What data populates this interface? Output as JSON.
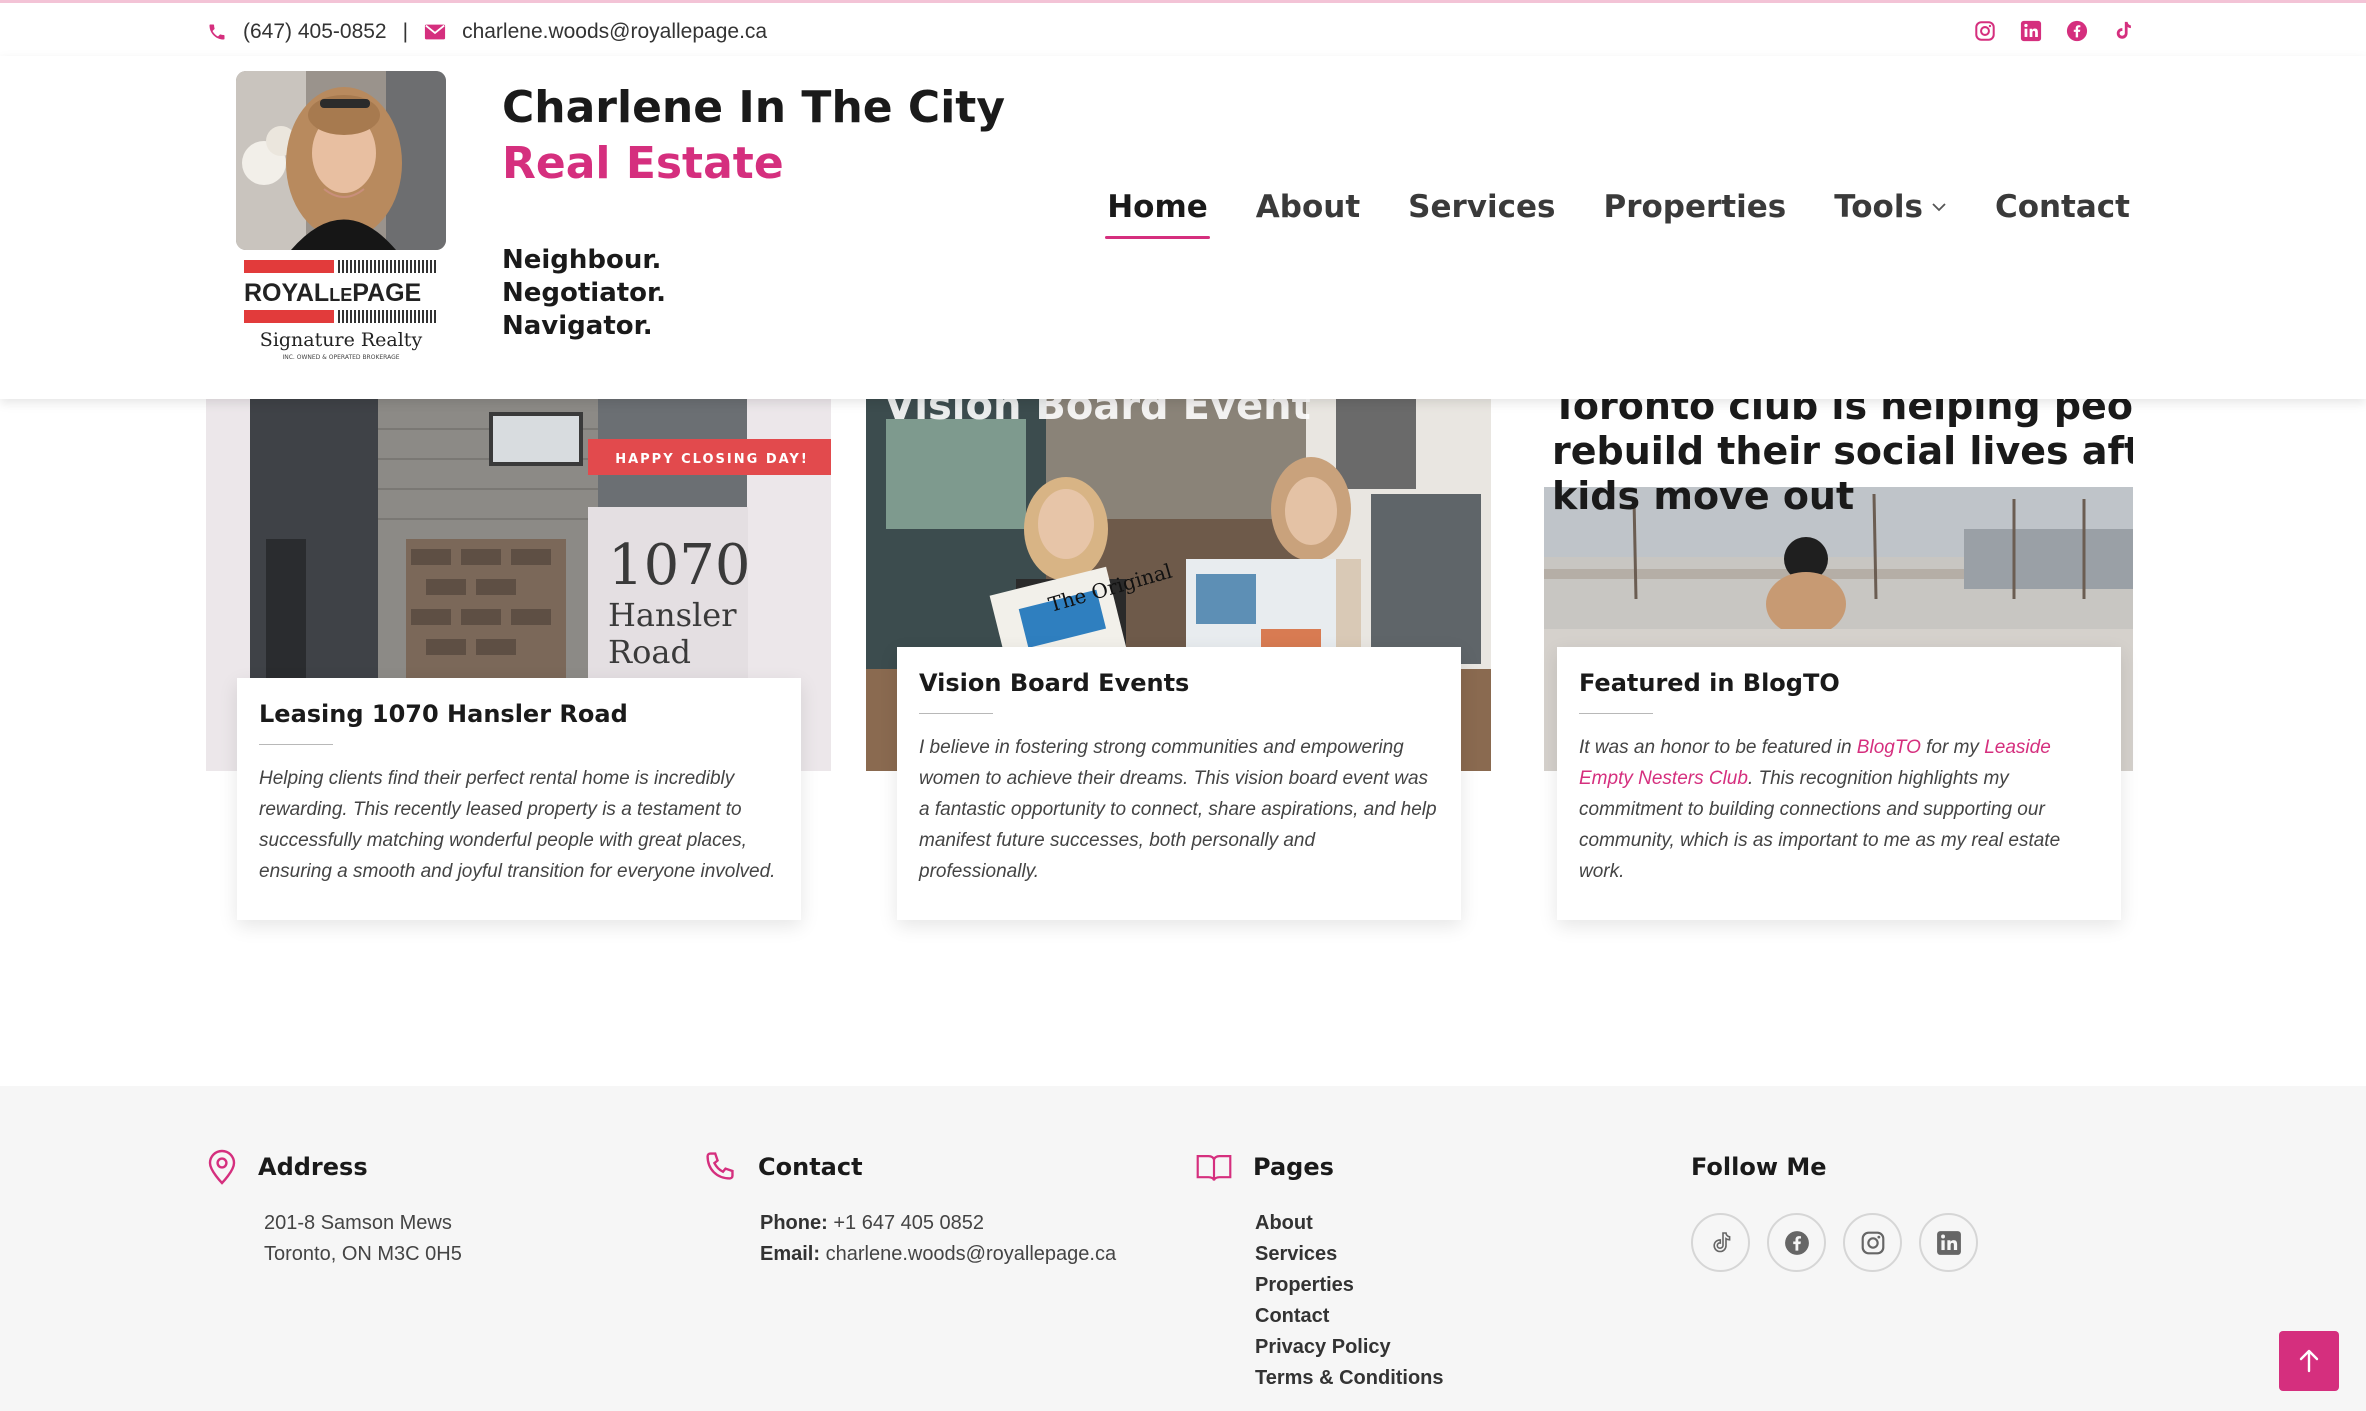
{
  "topbar": {
    "phone": "(647) 405-0852",
    "separator": "|",
    "email": "charlene.woods@royallepage.ca",
    "socials": [
      "instagram-icon",
      "linkedin-icon",
      "facebook-icon",
      "tiktok-icon"
    ]
  },
  "header": {
    "brand_line1": "Charlene In The City",
    "brand_line2": "Real Estate",
    "tagline": [
      "Neighbour.",
      "Negotiator.",
      "Navigator."
    ],
    "logo": {
      "royal": "ROYAL",
      "le": "LE",
      "page": "PAGE",
      "signature": "Signature Realty",
      "small": "INC. OWNED & OPERATED BROKERAGE"
    }
  },
  "nav": {
    "items": [
      "Home",
      "About",
      "Services",
      "Properties",
      "Tools",
      "Contact"
    ],
    "active": "Home"
  },
  "cards": [
    {
      "image_text": {
        "badge": "HAPPY CLOSING DAY!",
        "number": "1070",
        "street1": "Hansler",
        "street2": "Road"
      },
      "title": "Leasing 1070 Hansler Road",
      "body": "Helping clients find their perfect rental home is incredibly rewarding. This recently leased property is a testament to successfully matching wonderful people with great places, ensuring a smooth and joyful transition for everyone involved."
    },
    {
      "image_text": {
        "headline": "Vision Board Event",
        "board_label": "The Original"
      },
      "title": "Vision Board Events",
      "body": "I believe in fostering strong communities and empowering women to achieve their dreams. This vision board event was a fantastic opportunity to connect, share aspirations, and help manifest future successes, both personally and professionally."
    },
    {
      "image_text": {
        "headline1": "Toronto club is helping people",
        "headline2": "rebuild their social lives after",
        "headline3": "kids move out"
      },
      "title": "Featured in BlogTO",
      "body_parts": {
        "p1": "It was an honor to be featured in ",
        "link1": "BlogTO",
        "p2": " for my ",
        "link2": "Leaside Empty Nesters Club",
        "p3": ". This recognition highlights my commitment to building connections and supporting our community, which is as important to me as my real estate work."
      }
    }
  ],
  "footer": {
    "address": {
      "heading": "Address",
      "line1": "201-8 Samson Mews",
      "line2": "Toronto, ON M3C 0H5"
    },
    "contact": {
      "heading": "Contact",
      "phone_label": "Phone:",
      "phone": "+1 647 405 0852",
      "email_label": "Email:",
      "email": "charlene.woods@royallepage.ca"
    },
    "pages": {
      "heading": "Pages",
      "links": [
        "About",
        "Services",
        "Properties",
        "Contact",
        "Privacy Policy",
        "Terms & Conditions"
      ]
    },
    "follow": {
      "heading": "Follow Me",
      "icons": [
        "tiktok-icon",
        "facebook-icon",
        "instagram-icon",
        "linkedin-icon"
      ]
    }
  },
  "colors": {
    "accent": "#d52f7e",
    "footer_bg": "#f6f6f6",
    "text_dark": "#1a1a1a",
    "brand_red": "#e23b3b"
  }
}
